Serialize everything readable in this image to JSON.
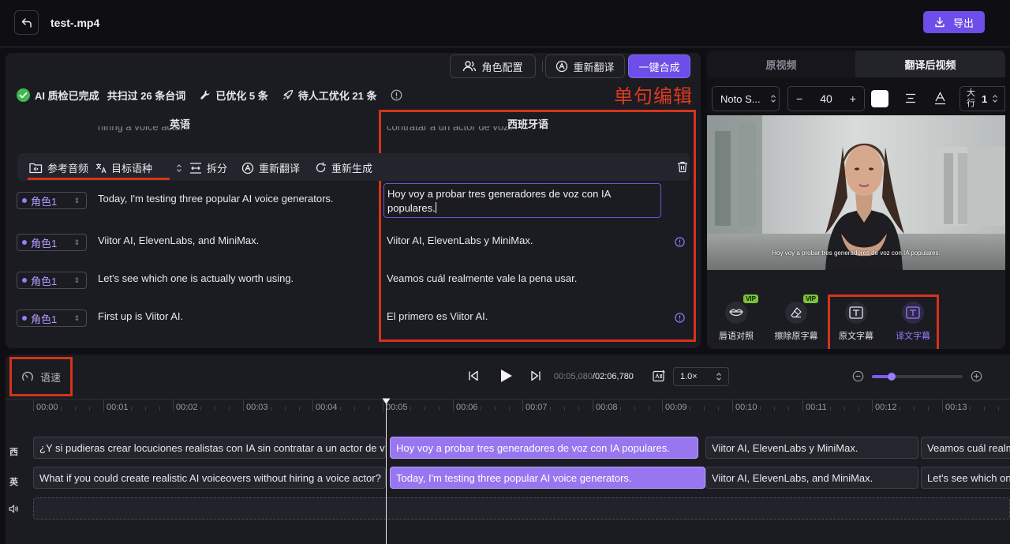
{
  "header": {
    "filename": "test-.mp4",
    "export_label": "导出"
  },
  "editor": {
    "role_config_label": "角色配置",
    "retranslate_label": "重新翻译",
    "one_click_label": "一键合成",
    "status": {
      "qc_done": "AI 质检已完成",
      "scanned": "共扫过 26 条台词",
      "optimized": "已优化 5 条",
      "pending": "待人工优化 21 条"
    },
    "annotation_sentence_edit": "单句编辑",
    "col_source": "英语",
    "col_target": "西班牙语",
    "clipped_source": "hiring a voice actor?",
    "clipped_target": "contratar a un actor de voz?",
    "seg_tools": {
      "ref_audio": "参考音频",
      "target_lang": "目标语种",
      "split": "拆分",
      "retranslate": "重新翻译",
      "regenerate": "重新生成"
    },
    "rows": [
      {
        "role": "角色1",
        "en": "Today, I'm testing three popular AI voice generators.",
        "es": "Hoy voy a probar tres generadores de voz con IA populares."
      },
      {
        "role": "角色1",
        "en": "Viitor AI, ElevenLabs, and MiniMax.",
        "es": "Viitor AI, ElevenLabs y MiniMax."
      },
      {
        "role": "角色1",
        "en": "Let's see which one is actually worth using.",
        "es": "Veamos cuál realmente vale la pena usar."
      },
      {
        "role": "角色1",
        "en": "First up is Viitor AI.",
        "es": "El primero es Viitor AI."
      }
    ]
  },
  "preview": {
    "tab_original": "原视频",
    "tab_translated": "翻译后视频",
    "font_name": "Noto S...",
    "font_size": "40",
    "case_label": "大行",
    "case_value": "1",
    "subtitle_text": "Hoy voy a probar tres generadores de voz con IA populares.",
    "features": [
      {
        "label": "唇语对照",
        "vip": "VIP"
      },
      {
        "label": "擦除原字幕",
        "vip": "VIP"
      },
      {
        "label": "原文字幕"
      },
      {
        "label": "译文字幕"
      }
    ]
  },
  "timeline": {
    "speed_label": "语速",
    "current_time": "00:05,080",
    "total_time": "/02:06,780",
    "rate": "1.0×",
    "ticks": [
      "00:00",
      "00:01",
      "00:02",
      "00:03",
      "00:04",
      "00:05",
      "00:06",
      "00:07",
      "00:08",
      "00:09",
      "00:10",
      "00:11",
      "00:12",
      "00:13"
    ],
    "track_es_label": "西",
    "track_en_label": "英",
    "es_clips": [
      "¿Y si pudieras crear locuciones realistas con IA sin contratar a un actor de voz?",
      "Hoy voy a probar tres generadores de voz con IA populares.",
      "Viitor AI, ElevenLabs y MiniMax.",
      "Veamos cuál realmente vale la pena usar."
    ],
    "en_clips": [
      "What if you could create realistic AI voiceovers without hiring a voice actor?",
      "Today, I'm testing three popular AI voice generators.",
      "Viitor AI, ElevenLabs, and MiniMax.",
      "Let's see which one is actually worth using."
    ]
  },
  "colors": {
    "accent": "#6d4ee8",
    "clip_selected": "#9876f0",
    "annotation_red": "#d4341b",
    "role_text": "#b49cff"
  }
}
